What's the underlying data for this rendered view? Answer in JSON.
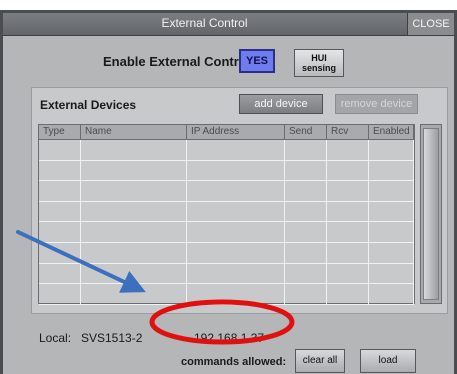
{
  "window": {
    "title": "External Control",
    "close_label": "CLOSE"
  },
  "enable": {
    "label": "Enable External Control:",
    "yes_label": "YES",
    "hui_line1": "HUI",
    "hui_line2": "sensing"
  },
  "devices": {
    "label": "External Devices",
    "add_label": "add device",
    "remove_label": "remove device",
    "columns": [
      "Type",
      "Name",
      "IP Address",
      "Send",
      "Rcv",
      "Enabled"
    ],
    "row_count": 8
  },
  "footer": {
    "local_label": "Local:",
    "local_name": "SVS1513-2",
    "ip_address": "192.168.1.37",
    "commands_label": "commands allowed:",
    "clear_label": "clear all",
    "load_label": "load"
  },
  "annotations": {
    "circle_color": "#e01010",
    "arrow_color": "#3d6fbf"
  },
  "colors": {
    "title_bar": "#6e7175",
    "yes_button": "#6e7cf0",
    "window_bg": "#b4b6b8"
  }
}
